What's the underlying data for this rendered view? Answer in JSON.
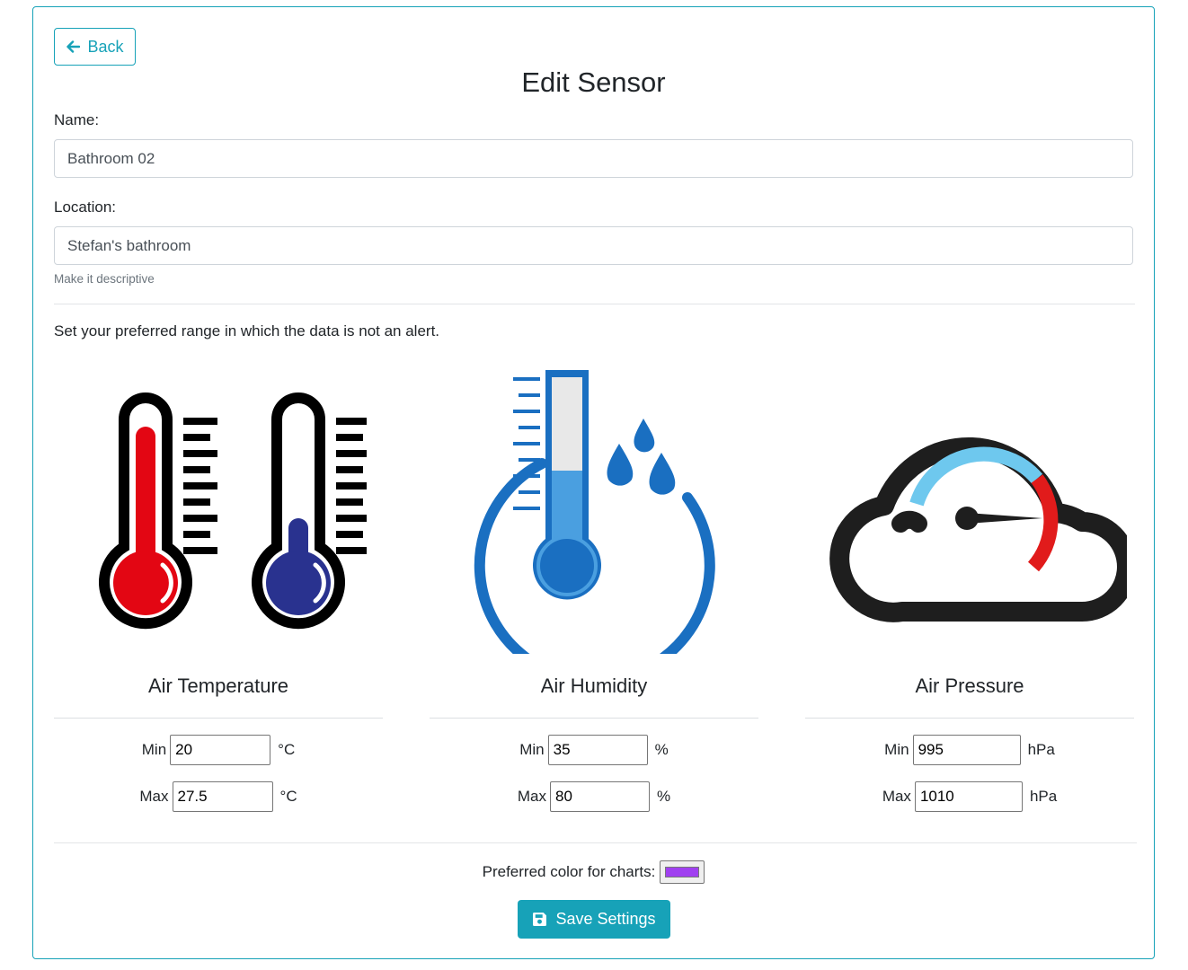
{
  "header": {
    "back_label": "Back",
    "title": "Edit Sensor"
  },
  "form": {
    "name_label": "Name:",
    "name_value": "Bathroom 02",
    "location_label": "Location:",
    "location_value": "Stefan's bathroom",
    "location_help": "Make it descriptive",
    "range_hint": "Set your preferred range in which the data is not an alert."
  },
  "sensors": [
    {
      "title": "Air Temperature",
      "icon": "thermometers-icon",
      "min_label": "Min",
      "min": "20",
      "max_label": "Max",
      "max": "27.5",
      "unit": "°C"
    },
    {
      "title": "Air Humidity",
      "icon": "humidity-thermometer-icon",
      "min_label": "Min",
      "min": "35",
      "max_label": "Max",
      "max": "80",
      "unit": "%"
    },
    {
      "title": "Air Pressure",
      "icon": "pressure-gauge-cloud-icon",
      "min_label": "Min",
      "min": "995",
      "max_label": "Max",
      "max": "1010",
      "unit": "hPa"
    }
  ],
  "chart_color": {
    "label": "Preferred color for charts:",
    "value": "#a040f0"
  },
  "save_label": "Save Settings",
  "colors": {
    "accent": "#17a2b8",
    "temp_hot": "#e30613",
    "temp_cold": "#29328f",
    "humidity_blue": "#1a6fc1",
    "pressure_light": "#6ec8ee",
    "pressure_red": "#e11b1b"
  }
}
